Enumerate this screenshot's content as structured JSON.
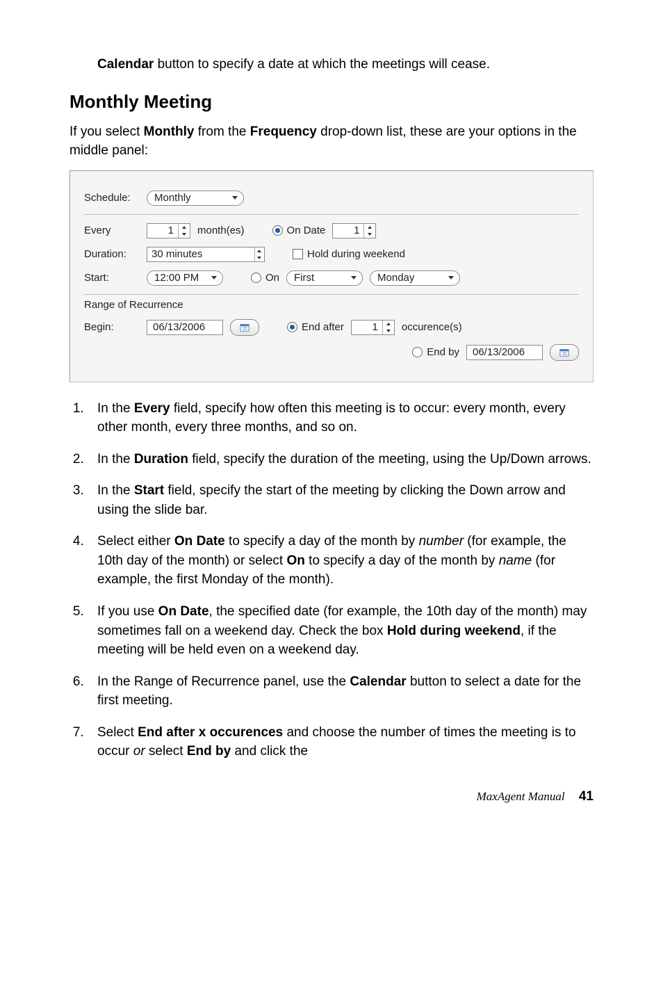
{
  "intro": {
    "calendar_word": "Calendar",
    "calendar_rest": " button to specify a date at which the meetings will cease."
  },
  "heading": "Monthly Meeting",
  "lead": {
    "pre": "If you select ",
    "monthly": "Monthly",
    "mid": " from the ",
    "frequency": "Frequency",
    "post": " drop-down list, these are your options in the middle panel:"
  },
  "panel": {
    "schedule_label": "Schedule:",
    "schedule_value": "Monthly",
    "every_label": "Every",
    "every_value": "1",
    "every_unit": "month(es)",
    "ondate_label": "On Date",
    "ondate_value": "1",
    "duration_label": "Duration:",
    "duration_value": "30 minutes",
    "hold_label": "Hold during weekend",
    "start_label": "Start:",
    "start_value": "12:00 PM",
    "on_label": "On",
    "on_ord": "First",
    "on_day": "Monday",
    "range_label": "Range of Recurrence",
    "begin_label": "Begin:",
    "begin_value": "06/13/2006",
    "endafter_label": "End after",
    "endafter_value": "1",
    "endafter_unit": "occurence(s)",
    "endby_label": "End by",
    "endby_value": "06/13/2006"
  },
  "steps": {
    "s1a": "In the ",
    "s1b": "Every",
    "s1c": " field, specify how often this meeting is to occur: every month, every other month, every three months, and so on.",
    "s2a": "In the ",
    "s2b": "Duration",
    "s2c": " field, specify the duration of the meeting, using the Up/Down arrows.",
    "s3a": "In the ",
    "s3b": "Start",
    "s3c": " field, specify the start of the meeting by clicking the Down arrow and using the slide bar.",
    "s4a": "Select either ",
    "s4b": "On Date",
    "s4c": " to specify a day of the month by ",
    "s4d": "number",
    "s4e": " (for example, the 10th day of the month) or select ",
    "s4f": "On",
    "s4g": " to specify a day of the month by ",
    "s4h": "name",
    "s4i": " (for example, the first Monday of the month).",
    "s5a": "If you use ",
    "s5b": "On Date",
    "s5c": ", the specified date (for example, the 10th day of the month) may sometimes fall on a weekend day. Check the box ",
    "s5d": "Hold during weekend",
    "s5e": ", if the meeting will be held even on a weekend day.",
    "s6a": "In the Range of Recurrence panel, use the ",
    "s6b": "Calendar",
    "s6c": " button to select a date for the first meeting.",
    "s7a": "Select ",
    "s7b": "End after x occurences",
    "s7c": " and choose the number of times the meeting is to occur ",
    "s7d": "or",
    "s7e": " select ",
    "s7f": "End by",
    "s7g": " and click the"
  },
  "footer": {
    "title": "MaxAgent Manual",
    "page": "41"
  },
  "chart_data": null
}
